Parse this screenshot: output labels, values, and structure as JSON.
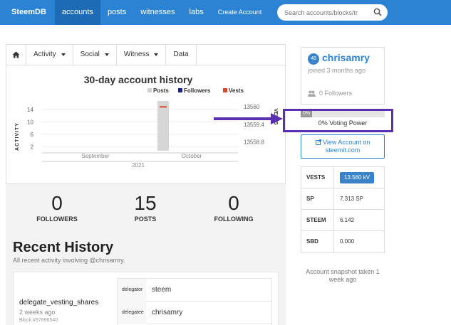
{
  "navbar": {
    "brand": "SteemDB",
    "items": [
      {
        "label": "accounts",
        "active": true
      },
      {
        "label": "posts",
        "active": false
      },
      {
        "label": "witnesses",
        "active": false
      },
      {
        "label": "labs",
        "active": false
      },
      {
        "label": "Create Account",
        "active": false
      }
    ],
    "search_placeholder": "Search accounts/blocks/tr"
  },
  "tabs": [
    {
      "label": "Activity",
      "dropdown": true
    },
    {
      "label": "Social",
      "dropdown": true
    },
    {
      "label": "Witness",
      "dropdown": true
    },
    {
      "label": "Data",
      "dropdown": false
    }
  ],
  "chart_data": {
    "type": "bar",
    "title": "30-day account history",
    "legend": [
      {
        "name": "Posts",
        "color": "#d0d0d0"
      },
      {
        "name": "Followers",
        "color": "#1a237e"
      },
      {
        "name": "Vests",
        "color": "#d94a2b"
      }
    ],
    "legend_position": "top-right",
    "ylabel_left": "ACTIVITY",
    "ylabel_right": "VESTS",
    "left_ticks": [
      "14",
      "10",
      "6",
      "2"
    ],
    "right_ticks": [
      "13560",
      "13559.4",
      "13558.8"
    ],
    "x_ticks": [
      "September",
      "October"
    ],
    "x_year": "2021",
    "ylim_left": [
      0,
      16
    ],
    "ylim_right": [
      13558.5,
      13560.2
    ],
    "vests_value": 13560
  },
  "counts": {
    "followers": {
      "value": "0",
      "label": "FOLLOWERS"
    },
    "posts": {
      "value": "15",
      "label": "POSTS"
    },
    "following": {
      "value": "0",
      "label": "FOLLOWING"
    }
  },
  "recent": {
    "title": "Recent History",
    "subtitle": "All recent activity involving @chrisamry.",
    "op_name": "delegate_vesting_shares",
    "op_time": "2 weeks ago",
    "op_block": "Block #57696540",
    "rows": [
      {
        "key": "delegator",
        "value": "steem"
      },
      {
        "key": "delegatee",
        "value": "chrisamry"
      }
    ]
  },
  "profile": {
    "reputation": "48",
    "username": "chrisamry",
    "joined": "joined 3 months ago",
    "followers": "0 Followers"
  },
  "voting": {
    "bar_label": "0%",
    "value_percent": 0,
    "label": "0% Voting Power"
  },
  "view_button": "View Account on steemit.com",
  "stats": [
    {
      "key": "VESTS",
      "value": "13.560 kV",
      "badge": true
    },
    {
      "key": "SP",
      "value": "7.313 SP",
      "badge": false
    },
    {
      "key": "STEEM",
      "value": "6.142",
      "badge": false
    },
    {
      "key": "SBD",
      "value": "0.000",
      "badge": false
    }
  ],
  "snapshot": "Account snapshot taken 1 week ago",
  "colors": {
    "primary": "#2c83d3",
    "highlight": "#5b2fb2"
  }
}
